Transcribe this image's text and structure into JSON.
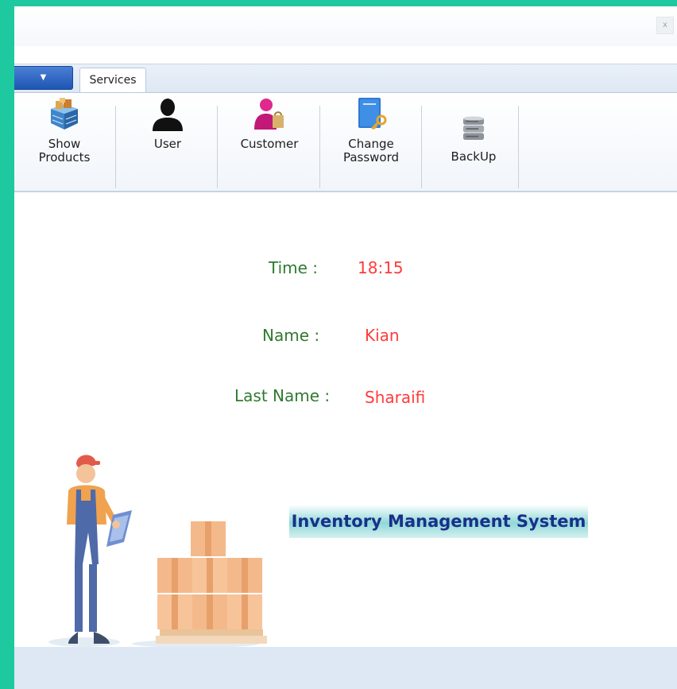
{
  "window": {
    "close_label": "x"
  },
  "tabs": {
    "app_menu_arrow": "▼",
    "active": "Services"
  },
  "ribbon": {
    "buttons": [
      {
        "label_line1": "Show",
        "label_line2": "Products",
        "icon": "products-box-icon"
      },
      {
        "label_line1": "User",
        "label_line2": "",
        "icon": "user-icon"
      },
      {
        "label_line1": "Customer",
        "label_line2": "",
        "icon": "customer-icon"
      },
      {
        "label_line1": "Change",
        "label_line2": "Password",
        "icon": "password-book-key-icon"
      },
      {
        "label_line1": "BackUp",
        "label_line2": "",
        "icon": "database-icon"
      }
    ]
  },
  "info": {
    "time_label": "Time :",
    "time_value": "18:15",
    "name_label": "Name :",
    "name_value": "Kian",
    "lastname_label": "Last Name :",
    "lastname_value": "Sharaifi"
  },
  "banner": {
    "title": "Inventory Management System"
  },
  "colors": {
    "background": "#1ec9a0",
    "label": "#2f7a2f",
    "value": "#ff3b3b",
    "banner_text": "#1a2f8a"
  }
}
